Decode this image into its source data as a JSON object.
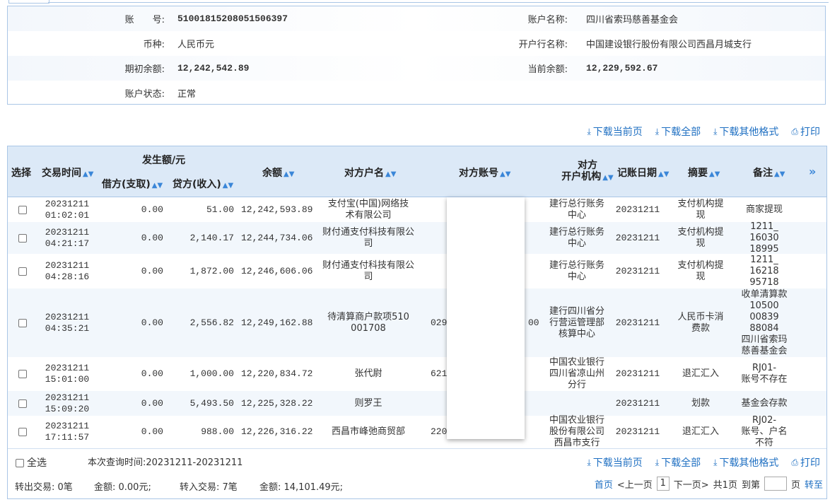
{
  "account": {
    "account_no_label": "账　　号:",
    "account_no": "51001815208051506397",
    "account_name_label": "账户名称:",
    "account_name": "四川省索玛慈善基金会",
    "currency_label": "币种:",
    "currency": "人民币元",
    "bank_label": "开户行名称:",
    "bank": "中国建设银行股份有限公司西昌月城支行",
    "opening_label": "期初余额:",
    "opening": "12,242,542.89",
    "current_label": "当前余额:",
    "current": "12,229,592.67",
    "status_label": "账户状态:",
    "status": "正常"
  },
  "actions": {
    "download_page": "下载当前页",
    "download_all": "下载全部",
    "download_other": "下载其他格式",
    "print": "打印"
  },
  "table": {
    "headers": {
      "select": "选择",
      "time": "交易时间",
      "amount_group": "发生额/元",
      "debit": "借方(支取)",
      "credit": "贷方(收入)",
      "balance": "余额",
      "cp_name": "对方户名",
      "cp_account": "对方账号",
      "cp_bank_1": "对方",
      "cp_bank_2": "开户机构",
      "post_date": "记账日期",
      "summary": "摘要",
      "remark": "备注",
      "more": "»"
    },
    "rows": [
      {
        "date": "20231211",
        "time": "01:02:01",
        "debit": "0.00",
        "credit": "51.00",
        "balance": "12,242,593.89",
        "cp_name": [
          "支付宝(中国)网络技",
          "术有限公司"
        ],
        "cp_account": "",
        "cp_bank": [
          "建行总行账务",
          "中心"
        ],
        "post": "20231211",
        "summary": [
          "支付机构提",
          "现"
        ],
        "remark": [
          "商家提现"
        ]
      },
      {
        "date": "20231211",
        "time": "04:21:17",
        "debit": "0.00",
        "credit": "2,140.17",
        "balance": "12,244,734.06",
        "cp_name": [
          "财付通支付科技有限公",
          "司"
        ],
        "cp_account": "",
        "cp_bank": [
          "建行总行账务",
          "中心"
        ],
        "post": "20231211",
        "summary": [
          "支付机构提",
          "现"
        ],
        "remark": [
          "1211_",
          "16030",
          "18995"
        ]
      },
      {
        "date": "20231211",
        "time": "04:28:16",
        "debit": "0.00",
        "credit": "1,872.00",
        "balance": "12,246,606.06",
        "cp_name": [
          "财付通支付科技有限公",
          "司"
        ],
        "cp_account": "",
        "cp_bank": [
          "建行总行账务",
          "中心"
        ],
        "post": "20231211",
        "summary": [
          "支付机构提",
          "现"
        ],
        "remark": [
          "1211_",
          "16218",
          "95718"
        ]
      },
      {
        "date": "20231211",
        "time": "04:35:21",
        "debit": "0.00",
        "credit": "2,556.82",
        "balance": "12,249,162.88",
        "cp_name": [
          "待清算商户款项510",
          "001708"
        ],
        "cp_account": "029",
        "cp_account_tail": "00",
        "cp_bank": [
          "建行四川省分",
          "行营运管理部",
          "核算中心"
        ],
        "post": "20231211",
        "summary": [
          "人民币卡消",
          "费款"
        ],
        "remark": [
          "收单清算款",
          "10500",
          "00839",
          "88084",
          "四川省索玛",
          "慈善基金会"
        ]
      },
      {
        "date": "20231211",
        "time": "15:01:00",
        "debit": "0.00",
        "credit": "1,000.00",
        "balance": "12,220,834.72",
        "cp_name": [
          "张代尉"
        ],
        "cp_account": "621",
        "cp_bank": [
          "中国农业银行",
          "四川省凉山州",
          "分行"
        ],
        "post": "20231211",
        "summary": [
          "退汇汇入"
        ],
        "remark": [
          "RJ01-",
          "账号不存在"
        ]
      },
      {
        "date": "20231211",
        "time": "15:09:20",
        "debit": "0.00",
        "credit": "5,493.50",
        "balance": "12,225,328.22",
        "cp_name": [
          "则罗王"
        ],
        "cp_account": "",
        "cp_bank": [],
        "post": "20231211",
        "summary": [
          "划款"
        ],
        "remark": [
          "基金会存款"
        ]
      },
      {
        "date": "20231211",
        "time": "17:11:57",
        "debit": "0.00",
        "credit": "988.00",
        "balance": "12,226,316.22",
        "cp_name": [
          "西昌市峰弛商贸部"
        ],
        "cp_account": "220",
        "cp_bank": [
          "中国农业银行",
          "股份有限公司",
          "西昌市支行"
        ],
        "post": "20231211",
        "summary": [
          "退汇汇入"
        ],
        "remark": [
          "RJ02-",
          "账号、户名",
          "不符"
        ]
      }
    ]
  },
  "footer": {
    "select_all": "全选",
    "query_time": "本次查询时间:20231211-20231211",
    "out_tx": "转出交易: 0笔",
    "out_amt": "金额: 0.00元;",
    "in_tx": "转入交易: 7笔",
    "in_amt": "金额: 14,101.49元;",
    "first": "首页",
    "prev": "<上一页",
    "page": "1",
    "next": "下一页>",
    "total": "共1页",
    "goto": "到第",
    "page_unit": "页",
    "go": "转至"
  }
}
